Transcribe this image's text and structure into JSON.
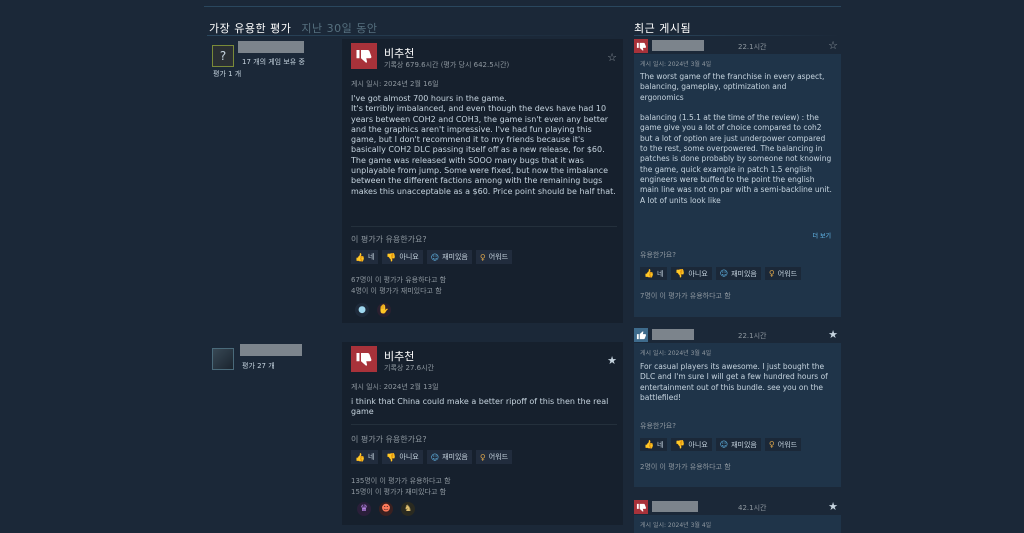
{
  "left_header": {
    "title": "가장 유용한 평가",
    "subtitle": "지난 30일 동안"
  },
  "right_header": {
    "title": "최근 게시됨"
  },
  "reviews": [
    {
      "avatar_glyph": "?",
      "games_owned": "17 개의 게임 보유 중",
      "review_count": "평가 1 개",
      "verdict": "비추천",
      "hours": "기록상 679.6시간 (평가 당시 642.5시간)",
      "posted": "게시 일시: 2024년 2월 16일",
      "text": "I've got almost 700 hours in the game.\nIt's terribly imbalanced, and even though the devs have had 10 years between COH2 and COH3, the game isn't even any better and the graphics aren't impressive. I've had fun playing this game, but I don't recommend it to my friends because it's basically COH2 DLC passing itself off as a new release, for $60. The game was released with SOOO many bugs that it was unplayable from jump. Some were fixed, but now the imbalance between the different factions among with the remaining bugs makes this unacceptable as a $60. Price point should be half that.",
      "helpful_q": "이 평가가 유용한가요?",
      "stat1": "67명이 이 평가가 유용하다고 함",
      "stat2": "4명이 이 평가가 재미있다고 함"
    },
    {
      "review_count": "평가 27 개",
      "verdict": "비추천",
      "hours": "기록상 27.6시간",
      "posted": "게시 일시: 2024년 2월 13일",
      "text": "i think that China could make a better ripoff of this then the real game",
      "helpful_q": "이 평가가 유용한가요?",
      "stat1": "135명이 이 평가가 유용하다고 함",
      "stat2": "15명이 이 평가가 재미있다고 함"
    }
  ],
  "buttons": {
    "yes": "네",
    "no": "아니요",
    "funny": "재미있음",
    "award": "어워드"
  },
  "posts": [
    {
      "time": "22.1시간",
      "posted": "게시 일시: 2024년 3월 4일",
      "text": "The worst game of the franchise in every aspect, balancing, gameplay, optimization and ergonomics\n\nbalancing (1.5.1 at the time of the review) : the game give you a lot of choice compared to coh2 but a lot of option are just underpower compared to the rest, some overpowered. The balancing in patches is done probably by someone not knowing the game, quick example in patch 1.5 english engineers were buffed to the point the english main line was not on par with a semi-backline unit. A lot of units look like",
      "more": "더 보기",
      "q": "유용한가요?",
      "stat": "7명이 이 평가가 유용하다고 함"
    },
    {
      "time": "22.1시간",
      "posted": "게시 일시: 2024년 3월 4일",
      "text": "For casual players its awesome. I just bought the DLC and I'm sure I will get a few hundred hours of entertainment out of this bundle. see you on the battlefiled!",
      "q": "유용한가요?",
      "stat": "2명이 이 평가가 유용하다고 함"
    },
    {
      "time": "42.1시간",
      "posted": "게시 일시: 2024년 3월 4일"
    }
  ]
}
